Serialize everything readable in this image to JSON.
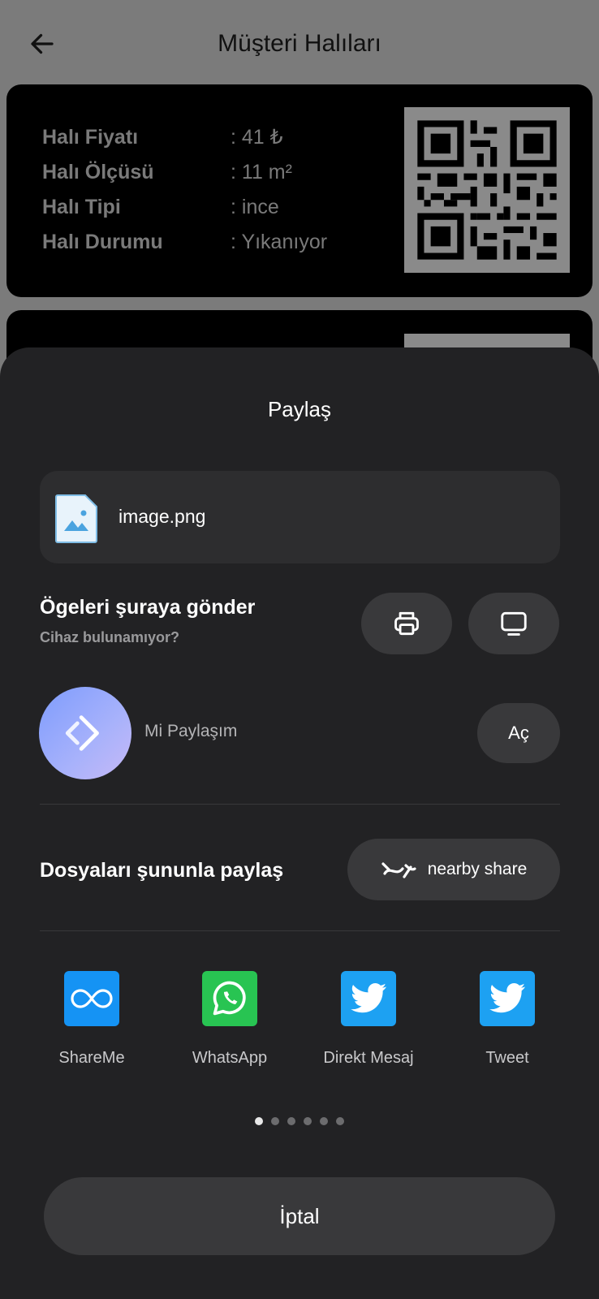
{
  "app_bar": {
    "title": "Müşteri Halıları",
    "back_icon": "arrow-left-icon"
  },
  "carpet_card": {
    "rows": [
      {
        "label": "Halı Fiyatı",
        "value": ": 41 ₺"
      },
      {
        "label": "Halı Ölçüsü",
        "value": ": 11 m²"
      },
      {
        "label": "Halı Tipi",
        "value": ": ince"
      },
      {
        "label": "Halı Durumu",
        "value": ": Yıkanıyor"
      }
    ],
    "qr_icon": "qr-code-icon"
  },
  "share_sheet": {
    "title": "Paylaş",
    "file": {
      "name": "image.png",
      "icon": "image-file-icon"
    },
    "send_to": {
      "title": "Ögeleri şuraya gönder",
      "subtitle": "Cihaz bulunamıyor?"
    },
    "mi_share": {
      "label": "Mi Paylaşım",
      "open_label": "Aç"
    },
    "share_with": {
      "title": "Dosyaları şununla paylaş",
      "nearby_label": "nearby share"
    },
    "apps": [
      {
        "label": "ShareMe",
        "color": "#1593f4"
      },
      {
        "label": "WhatsApp",
        "color": "#28c452"
      },
      {
        "label": "Direkt Mesaj",
        "color": "#1da1f2"
      },
      {
        "label": "Tweet",
        "color": "#1da1f2"
      }
    ],
    "page_count": 6,
    "active_page": 1,
    "cancel_label": "İptal"
  }
}
